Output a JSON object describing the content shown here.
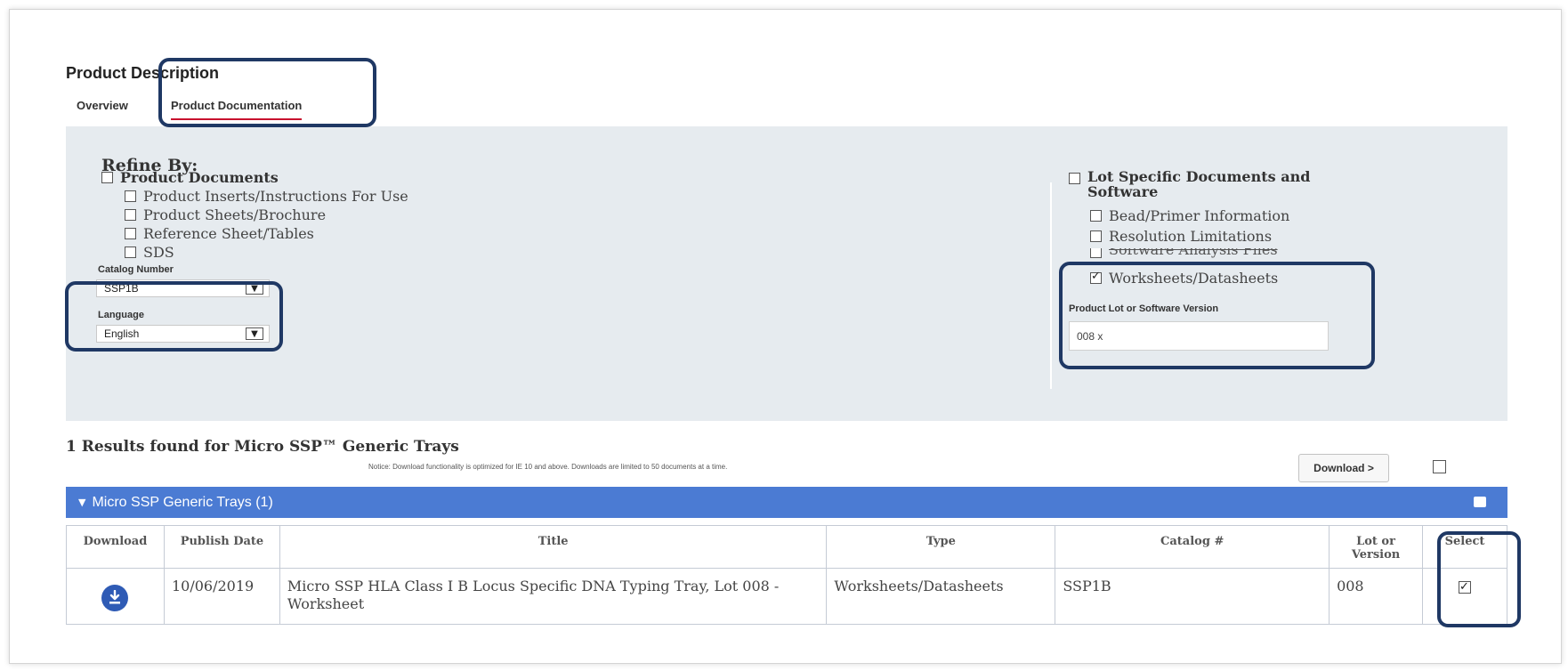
{
  "page": {
    "title": "Product Description",
    "tabs": [
      "Overview",
      "Product Documentation"
    ]
  },
  "refine": {
    "title": "Refine By:",
    "product_documents": {
      "label": "Product Documents",
      "items": [
        "Product Inserts/Instructions For Use",
        "Product Sheets/Brochure",
        "Reference Sheet/Tables",
        "SDS"
      ]
    },
    "catalog_number": {
      "label": "Catalog Number",
      "value": "SSP1B"
    },
    "language": {
      "label": "Language",
      "value": "English"
    },
    "lot_specific": {
      "label": "Lot Specific Documents and Software",
      "items": [
        {
          "label": "Bead/Primer Information",
          "checked": false
        },
        {
          "label": "Resolution Limitations",
          "checked": false
        },
        {
          "label": "Software Analysis Files",
          "checked": false
        },
        {
          "label": "Worksheets/Datasheets",
          "checked": true
        }
      ]
    },
    "lot_version": {
      "label": "Product Lot or Software Version",
      "value": "008 x"
    }
  },
  "results": {
    "summary": "1 Results found for Micro SSP™ Generic Trays",
    "notice": "Notice: Download functionality is optimized for IE 10 and above. Downloads are limited to 50 documents at a time.",
    "download_button": "Download >",
    "group_label": "Micro SSP Generic Trays (1)",
    "columns": [
      "Download",
      "Publish Date",
      "Title",
      "Type",
      "Catalog #",
      "Lot or Version",
      "Select"
    ],
    "rows": [
      {
        "publish_date": "10/06/2019",
        "title": "Micro SSP HLA Class I B Locus Specific DNA Typing Tray, Lot 008 - Worksheet",
        "type": "Worksheets/Datasheets",
        "catalog": "SSP1B",
        "lot": "008",
        "selected": true
      }
    ]
  },
  "colors": {
    "highlight_border": "#1f3864",
    "panel_bg": "#e6ebef",
    "group_bar": "#4b7bd3",
    "tab_underline": "#c8102e",
    "download_icon": "#2f5bb5"
  }
}
